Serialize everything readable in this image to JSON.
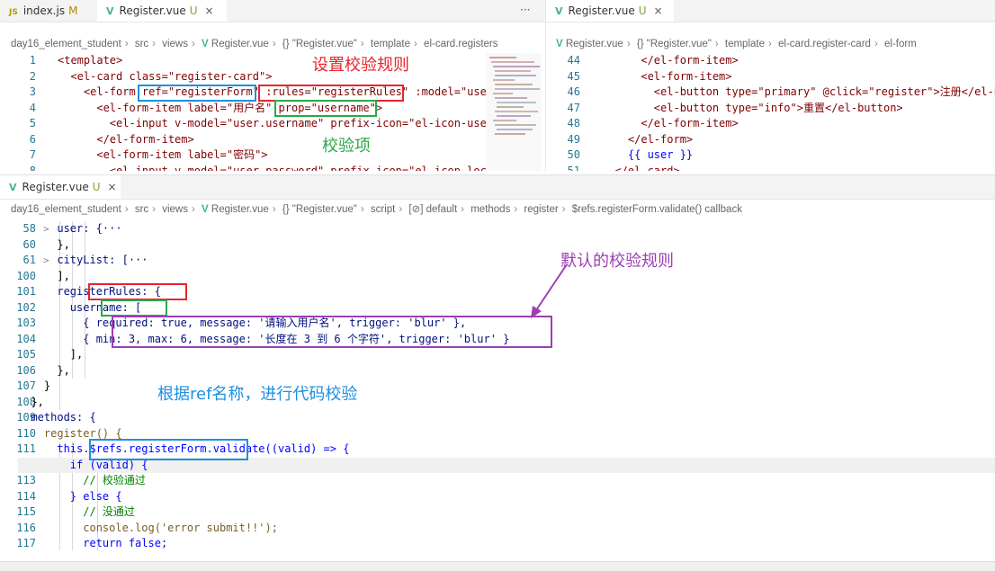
{
  "top_left_tabs": [
    {
      "icon": "JS",
      "label": "index.js",
      "badge": "M"
    },
    {
      "icon": "V",
      "label": "Register.vue",
      "badge": "U",
      "close": "×"
    }
  ],
  "more_actions": "···",
  "top_right_tab": {
    "icon": "V",
    "label": "Register.vue",
    "badge": "U",
    "close": "×"
  },
  "breadcrumb_left": [
    "day16_element_student",
    "src",
    "views",
    "Register.vue",
    "{} \"Register.vue\"",
    "template",
    "el-card.registers"
  ],
  "breadcrumb_right": [
    "Register.vue",
    "{} \"Register.vue\"",
    "template",
    "el-card.register-card",
    "el-form"
  ],
  "breadcrumb_bottom": [
    "day16_element_student",
    "src",
    "views",
    "Register.vue",
    "{} \"Register.vue\"",
    "script",
    "[⊘] default",
    "methods",
    "register",
    "$refs.registerForm.validate() callback"
  ],
  "bottom_tab": {
    "icon": "V",
    "label": "Register.vue",
    "badge": "U",
    "close": "×"
  },
  "left_editor": {
    "line_numbers": [
      "1",
      "2",
      "3",
      "4",
      "5",
      "6",
      "7",
      "8"
    ],
    "lines": [
      "<template>",
      "  <el-card class=\"register-card\">",
      "    <el-form ref=\"registerForm\" :rules=\"registerRules\" :model=\"user",
      "      <el-form-item label=\"用户名\" prop=\"username\">",
      "        <el-input v-model=\"user.username\" prefix-icon=\"el-icon-user",
      "      </el-form-item>",
      "      <el-form-item label=\"密码\">",
      "        <el-input v-model=\"user.password\" prefix-icon=\"el-icon-lock"
    ]
  },
  "right_editor": {
    "line_numbers": [
      "44",
      "45",
      "46",
      "47",
      "48",
      "49",
      "50",
      "51"
    ],
    "lines": [
      "      </el-form-item>",
      "      <el-form-item>",
      "        <el-button type=\"primary\" @click=\"register\">注册</el-b",
      "        <el-button type=\"info\">重置</el-button>",
      "      </el-form-item>",
      "    </el-form>",
      "    {{ user }}",
      "  </el-card>"
    ]
  },
  "bottom_editor": {
    "line_numbers": [
      "58",
      "60",
      "61",
      "100",
      "101",
      "102",
      "103",
      "104",
      "105",
      "106",
      "107",
      "108",
      "109",
      "110",
      "111",
      "112",
      "113",
      "114",
      "115",
      "116",
      "117"
    ],
    "fold_markers": [
      ">",
      "",
      ">",
      "",
      "",
      "",
      "",
      "",
      "",
      "",
      "",
      "",
      "",
      "",
      "",
      "",
      "",
      "",
      "",
      "",
      ""
    ],
    "lines": [
      "      user: {···",
      "      },",
      "      cityList: [···",
      "      ],",
      "      registerRules: {",
      "        username: [",
      "          { required: true, message: '请输入用户名', trigger: 'blur' },",
      "          { min: 3, max: 6, message: '长度在 3 到 6 个字符', trigger: 'blur' }",
      "        ],",
      "      },",
      "    }",
      "  },",
      "  methods: {",
      "    register() {",
      "      this.$refs.registerForm.validate((valid) => {",
      "        if (valid) {",
      "          // 校验通过",
      "        } else {",
      "          // 没通过",
      "          console.log('error submit!!');",
      "          return false;"
    ]
  },
  "annotations": {
    "set_rules": "设置校验规则",
    "validate_item": "校验项",
    "default_rules": "默认的校验规则",
    "by_ref": "根据ref名称，进行代码校验"
  },
  "colors": {
    "red": "#e8242b",
    "green": "#2aa84a",
    "blue": "#1f8fe0",
    "purple": "#8e44ad",
    "annotation_red": "#e8242b",
    "annotation_green": "#2aa84a",
    "annotation_blue": "#1f8fe0",
    "annotation_purple": "#9b3fb5"
  }
}
